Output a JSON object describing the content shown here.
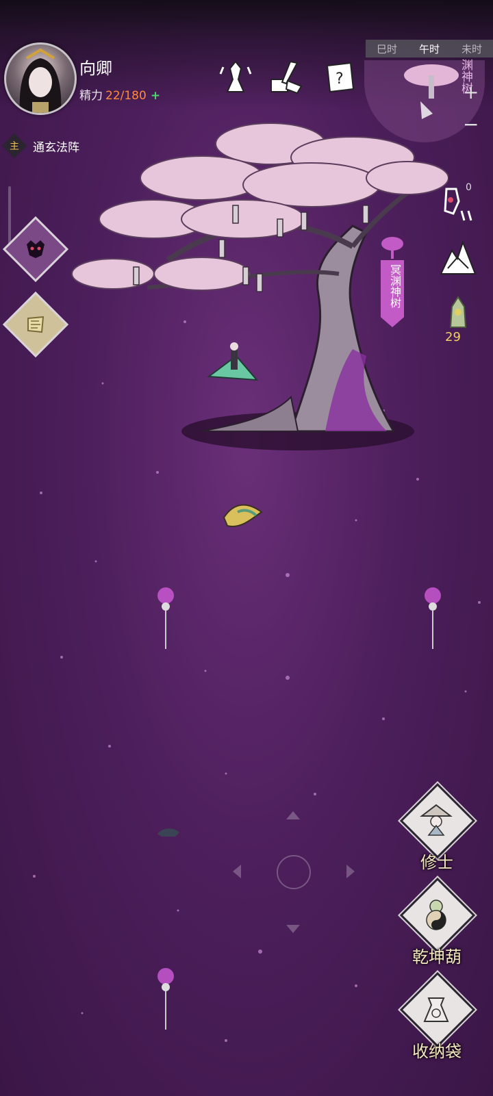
{
  "player": {
    "name": "向卿",
    "energy_label": "精力",
    "energy_value": "22/180",
    "energy_plus": "+"
  },
  "quest": {
    "tag": "主",
    "title": "通玄法阵"
  },
  "time_bar": {
    "items": [
      "巳时",
      "午时",
      "未时"
    ],
    "active": "午时"
  },
  "minimap": {
    "label": "渊神树",
    "zoom_in": "+",
    "zoom_out": "−"
  },
  "right_tools": {
    "lantern_count": "0",
    "relic_count": "29"
  },
  "map": {
    "tree_name": "冥渊神树"
  },
  "bottom_menu": {
    "cultivator": "修士",
    "gourd": "乾坤葫",
    "storage": "收纳袋"
  },
  "colors": {
    "background": "#4d1f5c",
    "energy_value": "#ff8a3c",
    "energy_plus": "#48d86a",
    "quest_tag": "#f0c04a",
    "tree_flag": "#c25bc6"
  }
}
